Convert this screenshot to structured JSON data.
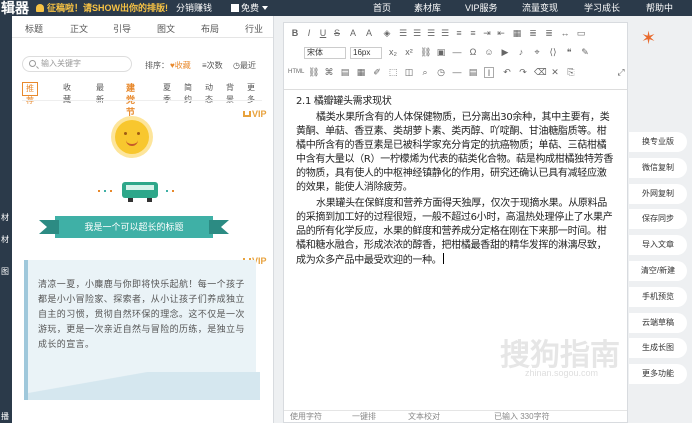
{
  "topbar": {
    "logo": "辑器",
    "promo": "征稿啦！请SHOW出你的排版!",
    "earn": "分销赚钱",
    "free": "免费",
    "nav": [
      "首页",
      "素材库",
      "VIP服务",
      "流量变现",
      "学习成长",
      "帮助中"
    ]
  },
  "sidebar_edge": [
    "材",
    "材",
    "图",
    "播"
  ],
  "left": {
    "tabs": [
      "标题",
      "正文",
      "引导",
      "图文",
      "布局",
      "行业"
    ],
    "search_placeholder": "输入关键字",
    "sort_label": "排序：",
    "sort_fav": "收藏",
    "sort_count": "次数",
    "sort_recent": "最近",
    "cats": [
      "推荐",
      "收藏",
      "最新"
    ],
    "hot": "建党节",
    "cats2": [
      "夏季",
      "简约",
      "动态",
      "背景",
      "更多"
    ],
    "vip": "VIP",
    "banner_title": "我是一个可以超长的标题",
    "card2_text": "清凉一夏，小麋鹿与你即将快乐起航！每一个孩子都是小小冒险家、探索者，从小让孩子们养成独立自主的习惯，贯彻自然环保的理念。这不仅是一次游玩，更是一次亲近自然与冒险的历练，是独立与成长的宣言。"
  },
  "editor": {
    "font": "宋体",
    "size": "16px",
    "heading": "2.1 橘瓣罐头需求现状",
    "para1": "橘类水果所含有的人体保健物质，已分离出30余种，其中主要有，类黄酮、单萜、香豆素、类胡萝卜素、类丙醇、吖啶酮、甘油糖脂质等。柑橘中所含有的香豆素是已被科学家充分肯定的抗癌物质；单萜、三萜柑橘中含有大量以（R）一柠檬烯为代表的萜类化合物。萜是构成柑橘独特芳香的物质，具有使人的中枢神经镇静化的作用，研究还确认已具有减轻应激的效果，能使人消除疲劳。",
    "para2": "水果罐头在保鲜度和营养方面得天独厚，仅次于现摘水果。从原料品的采摘到加工好的过程很短，一般不超过6小时，高温热处理停止了水果产品的所有化学反应，水果的鲜度和营养成分定格在刚在下来那一时间。柑橘和糖水融合，形成浓浓的醇香，把柑橘最香甜的精华发挥的淋漓尽致，成为众多产品中最受欢迎的一种。",
    "status": [
      "使用字符",
      "一键排",
      "文本校对",
      "已输入 330字符"
    ]
  },
  "right_buttons": [
    "换专业版",
    "微信复制",
    "外网复制",
    "保存同步",
    "导入文章",
    "清空/新建",
    "手机预览",
    "云端草稿",
    "生成长图",
    "更多功能"
  ],
  "watermark": "搜狗指南",
  "watermark_sub": "zhinan.sogou.com"
}
